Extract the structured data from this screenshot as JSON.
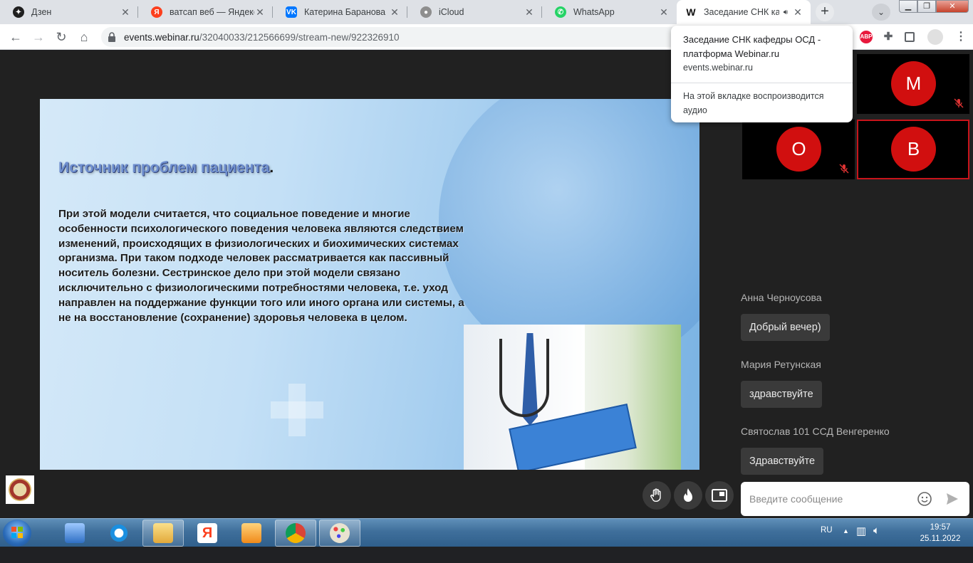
{
  "tabs": [
    {
      "title": "Дзен",
      "favicon_icon": "dzen-icon",
      "favicon_color": "#1f1f1f"
    },
    {
      "title": "ватсап веб — Яндекс: н",
      "favicon_icon": "yandex-icon",
      "favicon_color": "#fc3f1d"
    },
    {
      "title": "Катерина Баранова",
      "favicon_icon": "vk-icon",
      "favicon_color": "#0077ff"
    },
    {
      "title": "iCloud",
      "favicon_icon": "apple-icon",
      "favicon_color": "#8e8e8e"
    },
    {
      "title": "WhatsApp",
      "favicon_icon": "whatsapp-icon",
      "favicon_color": "#25d366"
    },
    {
      "title": "Заседание СНК каф",
      "favicon_icon": "webinar-w-icon",
      "favicon_color": "#111111",
      "active": true,
      "audio": true
    }
  ],
  "browser": {
    "url_domain": "events.webinar.ru",
    "url_path": "/32040033/212566699/stream-new/922326910"
  },
  "hover_card": {
    "title": "Заседание СНК кафедры ОСД - платформа Webinar.ru",
    "domain": "events.webinar.ru",
    "audio_notice": "На этой вкладке воспроизводится аудио"
  },
  "slide": {
    "title": "Источник проблем пациента",
    "title_suffix": ".",
    "body": "При этой модели считается, что социальное поведение и многие особенности психологического поведения человека являются следствием изменений, происходящих в физиологических и биохимических системах организма. При таком подходе человек рассматривается как пассивный носитель болезни. Сестринское дело при этой модели связано исключительно с физиологическими потребностями человека, т.е. уход направлен на поддержание функции того или иного органа или системы, а не на восстановление (сохранение) здоровья человека в целом."
  },
  "participants": [
    {
      "initial": "М",
      "muted": true,
      "speaking": false
    },
    {
      "initial": "О",
      "muted": true,
      "speaking": false
    },
    {
      "initial": "В",
      "muted": false,
      "speaking": true
    }
  ],
  "chat": {
    "messages": [
      {
        "author": "Анна Черноусова",
        "text": "Добрый вечер)"
      },
      {
        "author": "Мария Ретунская",
        "text": "здравствуйте"
      },
      {
        "author": "Святослав 101 ССД Венгеренко",
        "text": "Здравствуйте"
      }
    ],
    "input_placeholder": "Введите сообщение"
  },
  "controls": [
    "raise-hand-icon",
    "fire-reaction-icon",
    "picture-in-picture-icon"
  ],
  "taskbar": {
    "apps": [
      "speaker-app-icon",
      "ie-icon",
      "explorer-folder-icon",
      "yandex-browser-icon",
      "media-player-icon",
      "chrome-icon",
      "paint-icon"
    ],
    "language": "RU",
    "time": "19:57",
    "date": "25.11.2022"
  }
}
